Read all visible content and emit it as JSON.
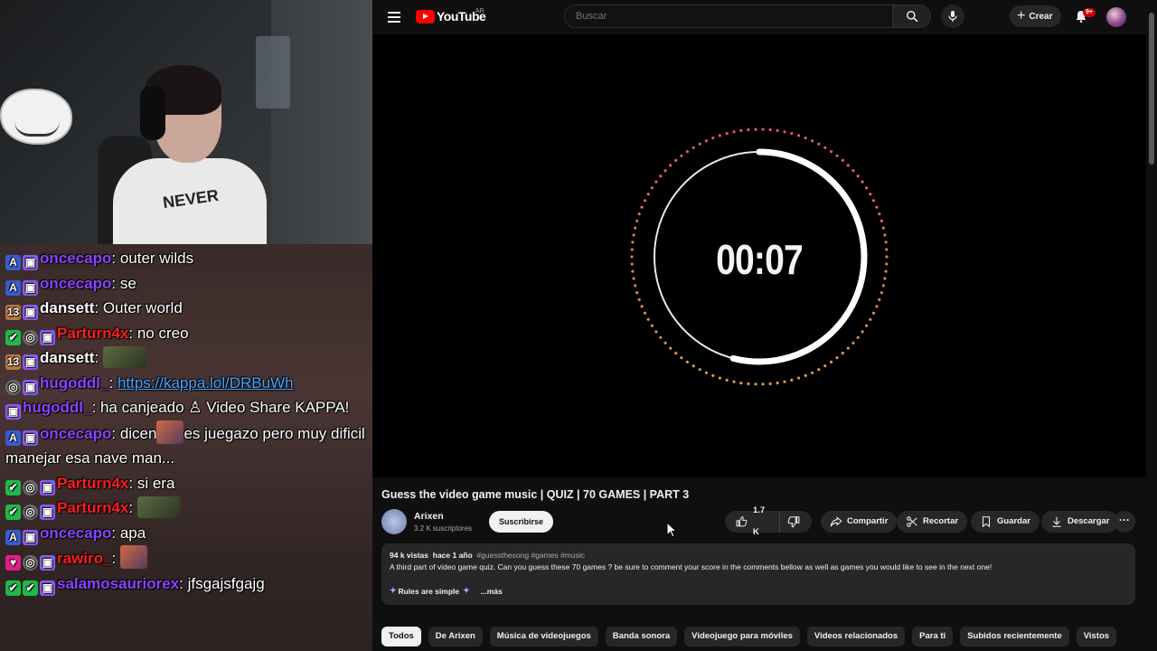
{
  "stream": {
    "shirt_text": "NEVER",
    "chat": [
      {
        "badges": [
          "A",
          "T"
        ],
        "user": "oncecapo",
        "color": "purple",
        "text": "outer wilds"
      },
      {
        "badges": [
          "A",
          "T"
        ],
        "user": "oncecapo",
        "color": "purple",
        "text": "se"
      },
      {
        "badges": [
          "Y",
          "T"
        ],
        "user": "dansett",
        "color": "white",
        "text": "Outer world"
      },
      {
        "badges": [
          "C",
          "S",
          "T"
        ],
        "user": "Parturn4x",
        "color": "red",
        "text": "no creo"
      },
      {
        "badges": [
          "Y",
          "T"
        ],
        "user": "dansett",
        "color": "white",
        "text": "",
        "emote": true
      },
      {
        "badges": [
          "S",
          "T"
        ],
        "user": "hugoddl_",
        "color": "purple",
        "text": "",
        "link": "https://kappa.lol/DRBuWh"
      },
      {
        "badges": [
          "T"
        ],
        "user": "hugoddl_",
        "color": "purple",
        "text": "ha canjeado ♙ Video Share KAPPA!"
      },
      {
        "badges": [
          "A",
          "T"
        ],
        "user": "oncecapo",
        "color": "purple",
        "text": "dicen",
        "emote_small": true,
        "text2": "es juegazo pero muy dificil manejar esa nave man..."
      },
      {
        "badges": [
          "C",
          "S",
          "T"
        ],
        "user": "Parturn4x",
        "color": "red",
        "text": "si era"
      },
      {
        "badges": [
          "C",
          "S",
          "T"
        ],
        "user": "Parturn4x",
        "color": "red",
        "text": "",
        "emote": true
      },
      {
        "badges": [
          "A",
          "T"
        ],
        "user": "oncecapo",
        "color": "purple",
        "text": "apa"
      },
      {
        "badges": [
          "H",
          "S",
          "T"
        ],
        "user": "rawiro_",
        "color": "red",
        "text": "",
        "emote_small": true
      },
      {
        "badges": [
          "C",
          "C",
          "T"
        ],
        "user": "salamosauriorex",
        "color": "purple",
        "text": "jfsgajsfgajg"
      }
    ]
  },
  "youtube": {
    "logo_text": "YouTube",
    "country": "AR",
    "search_placeholder": "Buscar",
    "create_label": "Crear",
    "notif_badge": "9+",
    "timer": "00:07",
    "ring_progress": 0.54,
    "title": "Guess the video game music | QUIZ | 70 GAMES | PART 3",
    "channel": "Arixen",
    "subscribers": "3.2 K suscriptores",
    "subscribe_label": "Suscribirse",
    "likes": "1.7 K",
    "share_label": "Compartir",
    "clip_label": "Recortar",
    "save_label": "Guardar",
    "download_label": "Descargar",
    "description": {
      "views": "94 k vistas",
      "date": "hace 1 año",
      "tags": "#guessthesong #games #music",
      "text": "A third part of video game quiz. Can you guess these 70 games ? be sure to comment your score in the comments bellow as well as games you would like to see in the next one!",
      "rules": "Rules are simple",
      "more": "...más"
    },
    "chips": [
      "Todos",
      "De Arixen",
      "Música de videojuegos",
      "Banda sonora",
      "Videojuego para móviles",
      "Videos relacionados",
      "Para ti",
      "Subidos recientemente",
      "Vistos"
    ],
    "colors": {
      "ring_inner": "#e8e8e8",
      "ring_outer_top": "#e05563",
      "ring_outer_bottom": "#d69a55",
      "brand_red": "#ff0000"
    }
  }
}
